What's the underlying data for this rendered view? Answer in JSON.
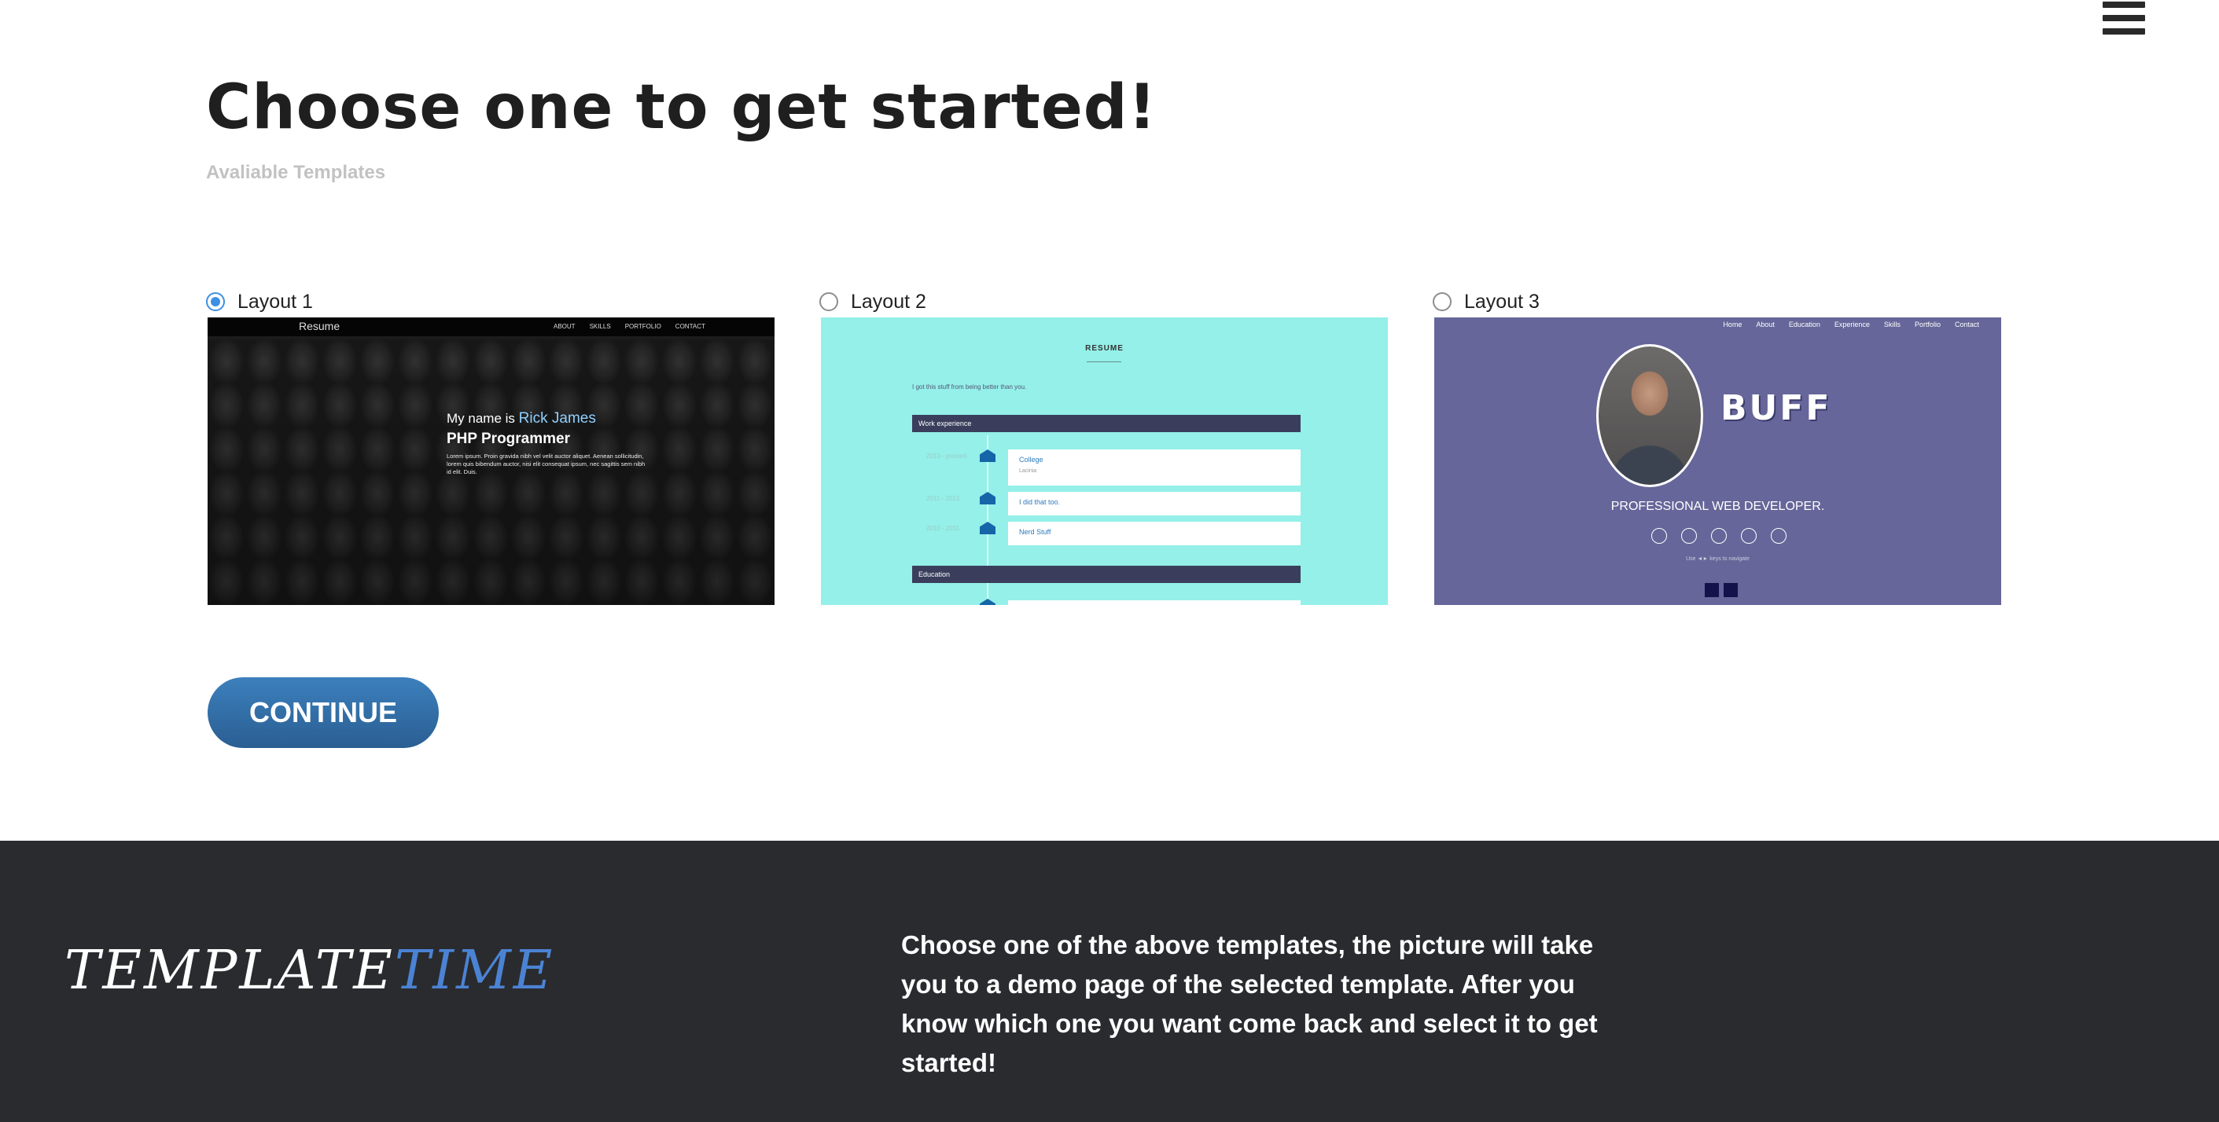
{
  "header": {
    "menu_icon": "hamburger-menu-icon",
    "title": "Choose one to get started!",
    "subtitle": "Avaliable Templates"
  },
  "layouts": [
    {
      "label": "Layout 1",
      "selected": true,
      "preview": {
        "brand": "Resume",
        "nav": [
          "ABOUT",
          "SKILLS",
          "PORTFOLIO",
          "CONTACT"
        ],
        "greeting": "My name is",
        "name": "Rick James",
        "role": "PHP Programmer",
        "text": "Lorem ipsum. Proin gravida nibh vel velit auctor aliquet. Aenean sollicitudin, lorem quis bibendum auctor, nisi elit consequat ipsum, nec sagittis sem nibh id elit. Duis."
      }
    },
    {
      "label": "Layout 2",
      "selected": false,
      "preview": {
        "heading": "RESUME",
        "intro": "I got this stuff from being better than you.",
        "section1": "Work experience",
        "items": [
          {
            "date": "2013 - present",
            "title": "College",
            "sub": "Lacinia"
          },
          {
            "date": "2011 - 2013",
            "title": "I did that too."
          },
          {
            "date": "2010 - 2011",
            "title": "Nerd Stuff"
          }
        ],
        "section2": "Education"
      }
    },
    {
      "label": "Layout 3",
      "selected": false,
      "preview": {
        "nav": [
          "Home",
          "About",
          "Education",
          "Experience",
          "Skills",
          "Portfolio",
          "Contact"
        ],
        "name": "BUFF",
        "role": "PROFESSIONAL WEB DEVELOPER.",
        "hint": "Use ◄► keys to navigate"
      }
    }
  ],
  "continue_label": "CONTINUE",
  "footer": {
    "logo_part1": "TEMPLATE",
    "logo_part2": "TIME",
    "text": "Choose one of the above templates, the picture will take you to a demo page of the selected template. After you know which one you want come back and select it to get started!"
  },
  "colors": {
    "accent": "#3d90e3",
    "button": "#2f6aa3",
    "footer_bg": "#2a2b2f",
    "logo_blue": "#4b83d4",
    "layout2_bg": "#94f0e8",
    "layout3_bg": "#66669a"
  }
}
